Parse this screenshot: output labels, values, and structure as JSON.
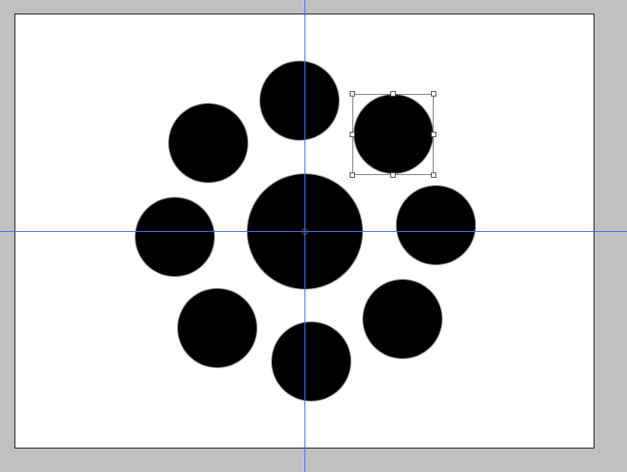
{
  "editor": {
    "workspace_color": "#c0c0c0",
    "canvas_color": "#ffffff",
    "guide_color": "#4a6cf2"
  },
  "document": {
    "shapes": [
      {
        "id": "center",
        "fill": "#000000"
      },
      {
        "id": "top",
        "fill": "#000000"
      },
      {
        "id": "top-right-selected",
        "fill": "#000000"
      },
      {
        "id": "right",
        "fill": "#000000"
      },
      {
        "id": "bottom-right",
        "fill": "#000000"
      },
      {
        "id": "bottom",
        "fill": "#000000"
      },
      {
        "id": "bottom-left",
        "fill": "#000000"
      },
      {
        "id": "left",
        "fill": "#000000"
      },
      {
        "id": "top-left",
        "fill": "#000000"
      }
    ]
  },
  "selection": {
    "active": true,
    "handles": 8
  }
}
